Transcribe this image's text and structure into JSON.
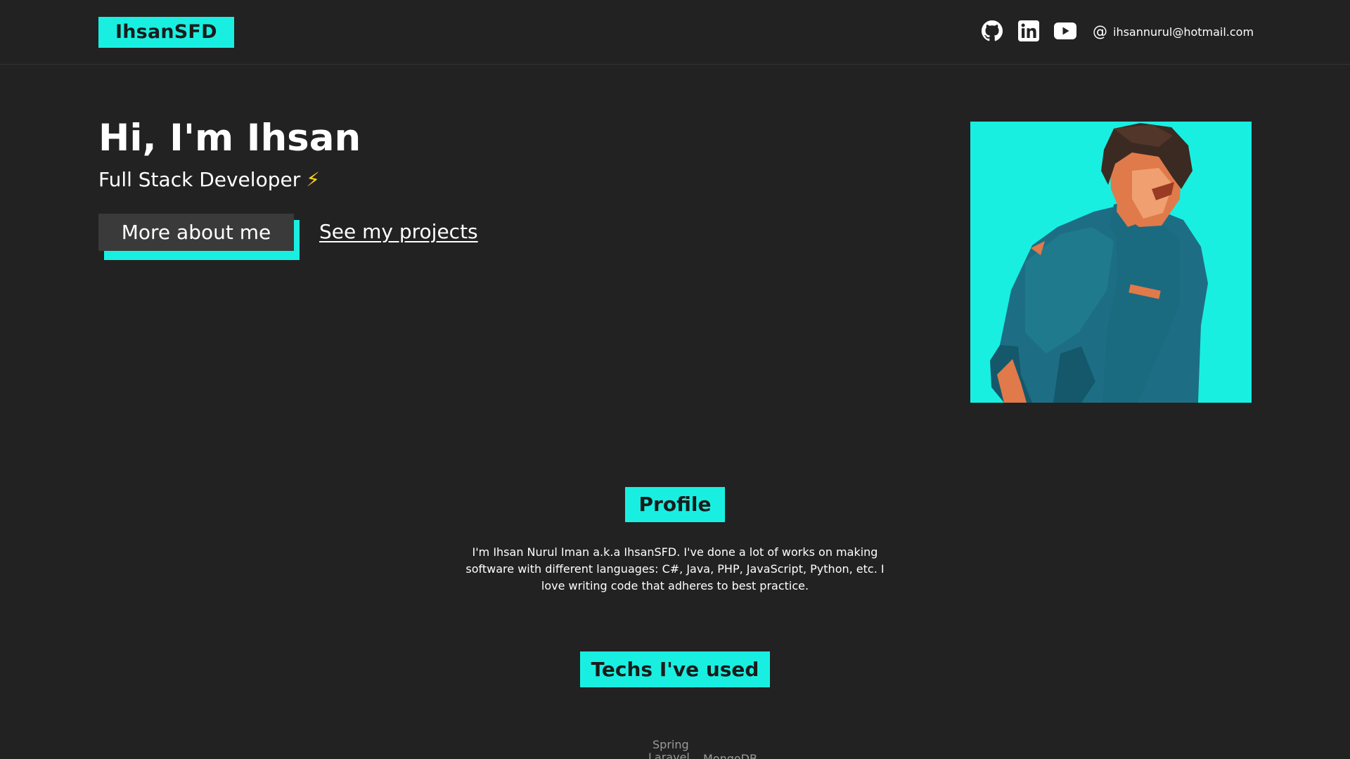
{
  "header": {
    "logo": "IhsanSFD",
    "social": [
      {
        "name": "github-icon"
      },
      {
        "name": "linkedin-icon"
      },
      {
        "name": "youtube-icon"
      }
    ],
    "email_icon": "@",
    "email": "ihsannurul@hotmail.com"
  },
  "hero": {
    "title": "Hi, I'm Ihsan",
    "subtitle": "Full Stack Developer",
    "subtitle_icon": "⚡",
    "more_button": "More about me",
    "projects_link": "See my projects"
  },
  "profile": {
    "badge": "Profile",
    "text": "I'm Ihsan Nurul Iman a.k.a IhsanSFD. I've done a lot of works on making software with different languages: C#, Java, PHP, JavaScript, Python, etc. I love writing code that adheres to best practice."
  },
  "techs": {
    "badge": "Techs I've used",
    "items": [
      "Spring",
      "Laravel",
      "MongoDB"
    ]
  },
  "colors": {
    "accent": "#19efe1",
    "background": "#222222",
    "button": "#3a3a3a",
    "bolt": "#ffd21a"
  }
}
